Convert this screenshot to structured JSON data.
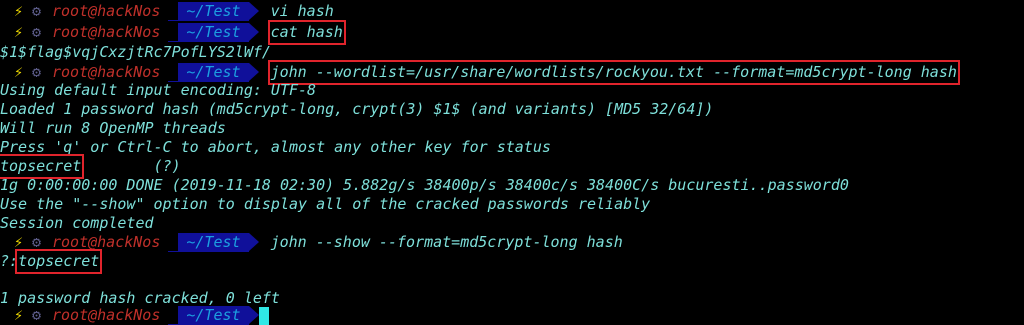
{
  "prompt": {
    "bolt": "⚡",
    "gear": "⚙",
    "user_host": "root@hackNos",
    "dir": "~/Test"
  },
  "lines": {
    "cmd1": "vi hash",
    "cmd2": "cat hash",
    "out_hash": "$1$flag$vqjCxzjtRc7PofLYS2lWf/",
    "cmd3": "john --wordlist=/usr/share/wordlists/rockyou.txt --format=md5crypt-long hash",
    "out1": "Using default input encoding: UTF-8",
    "out2": "Loaded 1 password hash (md5crypt-long, crypt(3) $1$ (and variants) [MD5 32/64])",
    "out3": "Will run 8 OpenMP threads",
    "out4": "Press 'q' or Ctrl-C to abort, almost any other key for status",
    "out5_pw": "topsecret",
    "out5_rest": "        (?)",
    "out6": "1g 0:00:00:00 DONE (2019-11-18 02:30) 5.882g/s 38400p/s 38400c/s 38400C/s bucuresti..password0",
    "out7": "Use the \"--show\" option to display all of the cracked passwords reliably",
    "out8": "Session completed",
    "cmd4": "john --show --format=md5crypt-long hash",
    "out9_prefix": "?:",
    "out9_pw": "topsecret",
    "out10": "1 password hash cracked, 0 left"
  }
}
